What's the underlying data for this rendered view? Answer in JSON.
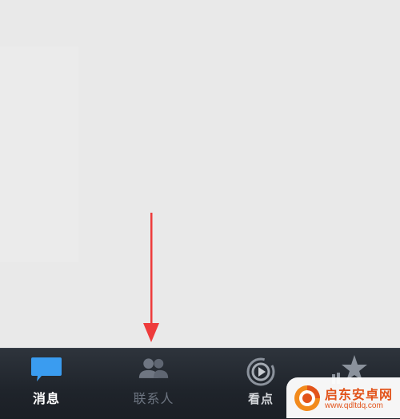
{
  "tabbar": {
    "tabs": [
      {
        "label": "消息",
        "icon": "chat-bubble-icon",
        "active": true
      },
      {
        "label": "联系人",
        "icon": "contacts-icon",
        "active": false
      },
      {
        "label": "看点",
        "icon": "play-circle-icon",
        "active": false
      },
      {
        "label": "",
        "icon": "star-icon",
        "active": false
      }
    ]
  },
  "colors": {
    "active_icon": "#3a9cf0",
    "tabbar_bg": "#23282f",
    "arrow": "#ee3b3b",
    "watermark_text": "#e2531a"
  },
  "watermark": {
    "title": "启东安卓网",
    "url": "www.qdltdq.com"
  }
}
